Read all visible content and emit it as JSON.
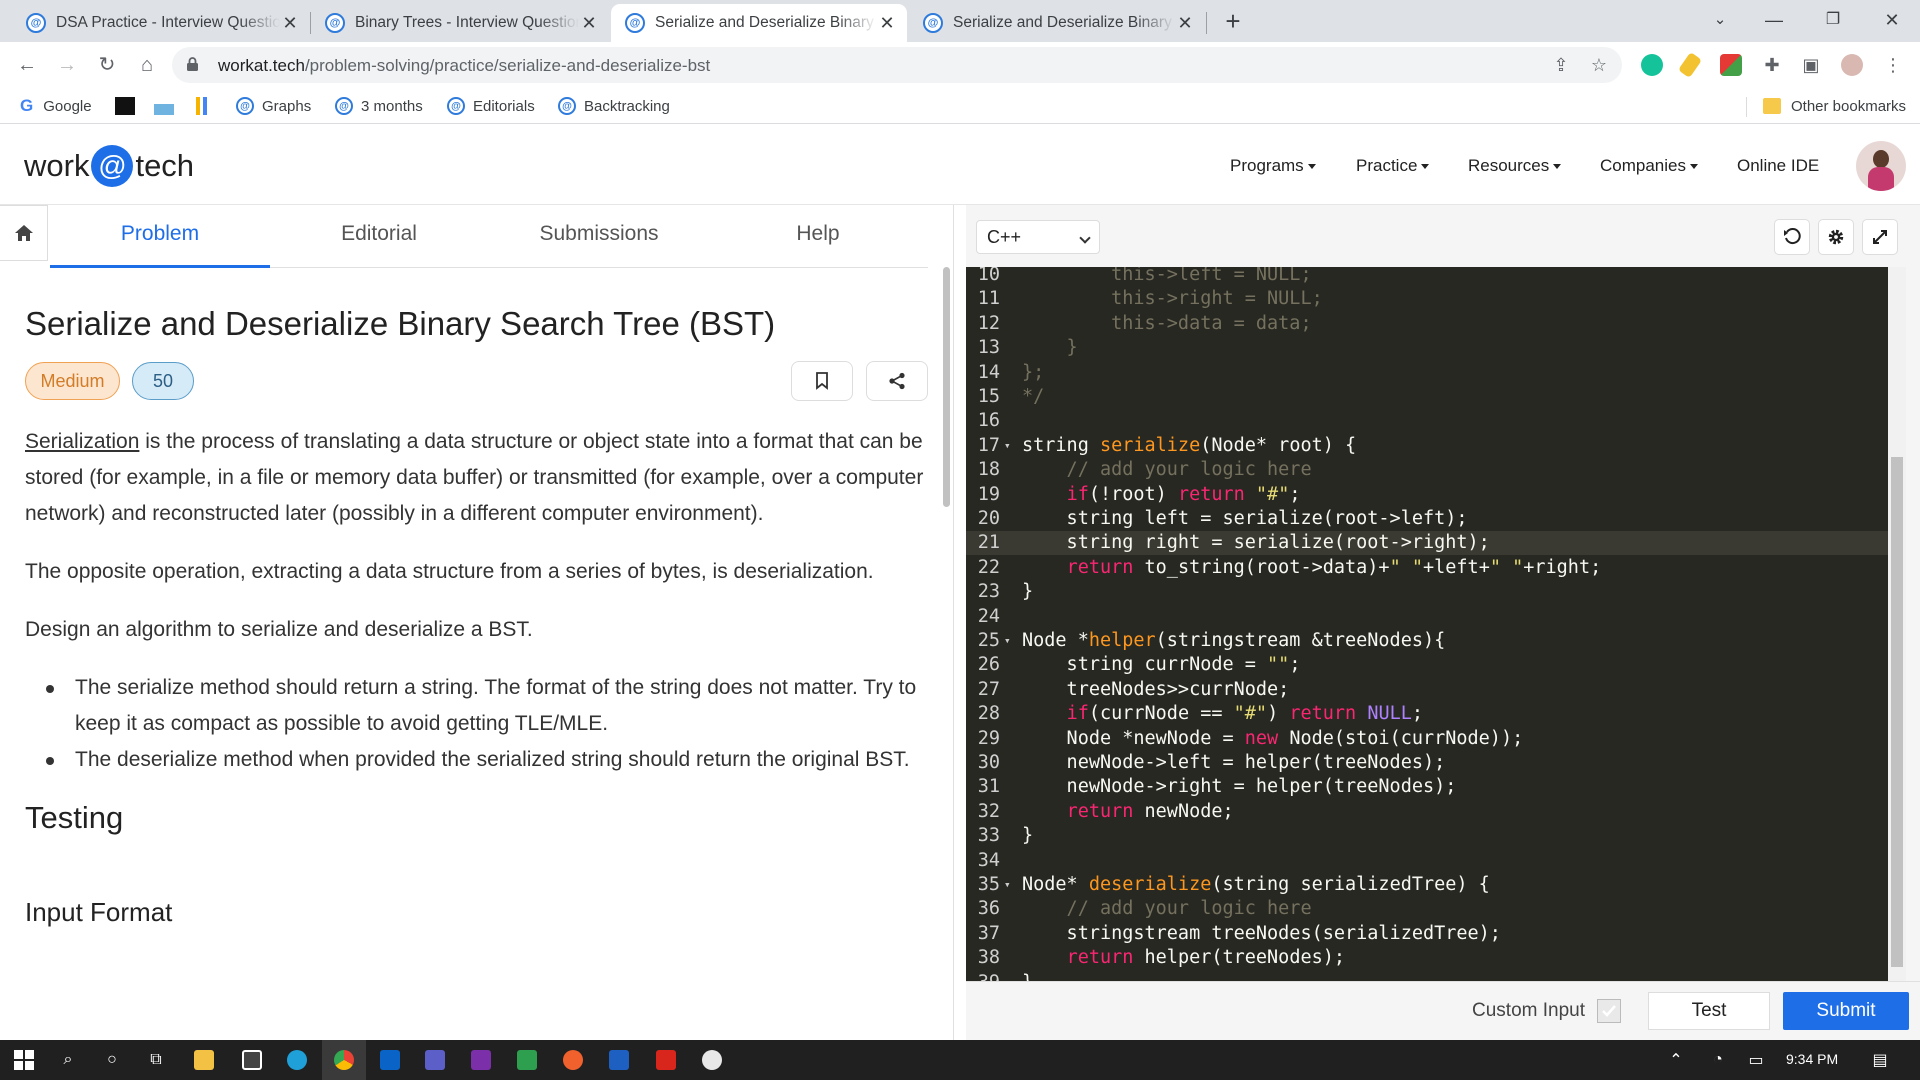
{
  "browser": {
    "tabs": [
      {
        "title": "DSA Practice - Interview Questions",
        "active": false
      },
      {
        "title": "Binary Trees - Interview Questions",
        "active": false
      },
      {
        "title": "Serialize and Deserialize Binary Search Tree",
        "active": true
      },
      {
        "title": "Serialize and Deserialize Binary Search Tree",
        "active": false
      }
    ],
    "url_host": "workat.tech",
    "url_path": "/problem-solving/practice/serialize-and-deserialize-bst",
    "bookmarks": [
      "Google",
      "Graphs",
      "3 months",
      "Editorials",
      "Backtracking"
    ],
    "other_bookmarks": "Other bookmarks"
  },
  "site": {
    "logo_left": "work",
    "logo_at": "@",
    "logo_right": "tech",
    "nav": [
      "Programs",
      "Practice",
      "Resources",
      "Companies",
      "Online IDE"
    ]
  },
  "problem": {
    "tabs": [
      "Problem",
      "Editorial",
      "Submissions",
      "Help"
    ],
    "title": "Serialize and Deserialize Binary Search Tree (BST)",
    "difficulty": "Medium",
    "points": "50",
    "para1_link": "Serialization",
    "para1_rest": " is the process of translating a data structure or object state into a format that can be stored (for example, in a file or memory data buffer) or transmitted (for example, over a computer network) and reconstructed later (possibly in a different computer environment).",
    "para2": "The opposite operation, extracting a data structure from a series of bytes, is deserialization.",
    "para3": "Design an algorithm to serialize and deserialize a BST.",
    "bullets": [
      "The serialize method should return a string. The format of the string does not matter. Try to keep it as compact as possible to avoid getting TLE/MLE.",
      "The deserialize method when provided the serialized string should return the original BST."
    ],
    "testing_heading": "Testing",
    "input_heading": "Input Format"
  },
  "editor": {
    "language": "C++",
    "custom_input_label": "Custom Input",
    "test_label": "Test",
    "submit_label": "Submit",
    "lines": [
      {
        "n": "10",
        "fold": "",
        "segs": [
          [
            "cm",
            "        this->left = NULL;"
          ]
        ]
      },
      {
        "n": "11",
        "fold": "",
        "segs": [
          [
            "cm",
            "        this->right = NULL;"
          ]
        ]
      },
      {
        "n": "12",
        "fold": "",
        "segs": [
          [
            "cm",
            "        this->data = data;"
          ]
        ]
      },
      {
        "n": "13",
        "fold": "",
        "segs": [
          [
            "cm",
            "    }"
          ]
        ]
      },
      {
        "n": "14",
        "fold": "",
        "segs": [
          [
            "cm",
            "};"
          ]
        ]
      },
      {
        "n": "15",
        "fold": "",
        "segs": [
          [
            "cm",
            "*/"
          ]
        ]
      },
      {
        "n": "16",
        "fold": "",
        "segs": [
          [
            "",
            ""
          ]
        ]
      },
      {
        "n": "17",
        "fold": "▾",
        "segs": [
          [
            "",
            "string "
          ],
          [
            "fn",
            "serialize"
          ],
          [
            "",
            "(Node* root) {"
          ]
        ]
      },
      {
        "n": "18",
        "fold": "",
        "segs": [
          [
            "cm",
            "    // add your logic here"
          ]
        ]
      },
      {
        "n": "19",
        "fold": "",
        "segs": [
          [
            "",
            "    "
          ],
          [
            "kw",
            "if"
          ],
          [
            "",
            "(!root) "
          ],
          [
            "kw",
            "return"
          ],
          [
            "",
            " "
          ],
          [
            "st",
            "\"#\""
          ],
          [
            "",
            ";"
          ]
        ]
      },
      {
        "n": "20",
        "fold": "",
        "segs": [
          [
            "",
            "    string left = serialize(root->left);"
          ]
        ]
      },
      {
        "n": "21",
        "fold": "",
        "hl": true,
        "segs": [
          [
            "",
            "    string right = serialize(root->right);"
          ]
        ]
      },
      {
        "n": "22",
        "fold": "",
        "segs": [
          [
            "",
            "    "
          ],
          [
            "kw",
            "return"
          ],
          [
            "",
            " to_string(root->data)+"
          ],
          [
            "st",
            "\" \""
          ],
          [
            "",
            "+left+"
          ],
          [
            "st",
            "\" \""
          ],
          [
            "",
            "+right;"
          ]
        ]
      },
      {
        "n": "23",
        "fold": "",
        "segs": [
          [
            "",
            "}"
          ]
        ]
      },
      {
        "n": "24",
        "fold": "",
        "segs": [
          [
            "",
            ""
          ]
        ]
      },
      {
        "n": "25",
        "fold": "▾",
        "segs": [
          [
            "",
            "Node *"
          ],
          [
            "fn",
            "helper"
          ],
          [
            "",
            "(stringstream &treeNodes){"
          ]
        ]
      },
      {
        "n": "26",
        "fold": "",
        "segs": [
          [
            "",
            "    string currNode = "
          ],
          [
            "st",
            "\"\""
          ],
          [
            "",
            ";"
          ]
        ]
      },
      {
        "n": "27",
        "fold": "",
        "segs": [
          [
            "",
            "    treeNodes>>currNode;"
          ]
        ]
      },
      {
        "n": "28",
        "fold": "",
        "segs": [
          [
            "",
            "    "
          ],
          [
            "kw",
            "if"
          ],
          [
            "",
            "(currNode == "
          ],
          [
            "st",
            "\"#\""
          ],
          [
            "",
            ") "
          ],
          [
            "kw",
            "return"
          ],
          [
            "",
            " "
          ],
          [
            "cn",
            "NULL"
          ],
          [
            "",
            ";"
          ]
        ]
      },
      {
        "n": "29",
        "fold": "",
        "segs": [
          [
            "",
            "    Node *newNode = "
          ],
          [
            "kw",
            "new"
          ],
          [
            "",
            " Node(stoi(currNode));"
          ]
        ]
      },
      {
        "n": "30",
        "fold": "",
        "segs": [
          [
            "",
            "    newNode->left = helper(treeNodes);"
          ]
        ]
      },
      {
        "n": "31",
        "fold": "",
        "segs": [
          [
            "",
            "    newNode->right = helper(treeNodes);"
          ]
        ]
      },
      {
        "n": "32",
        "fold": "",
        "segs": [
          [
            "",
            "    "
          ],
          [
            "kw",
            "return"
          ],
          [
            "",
            " newNode;"
          ]
        ]
      },
      {
        "n": "33",
        "fold": "",
        "segs": [
          [
            "",
            "}"
          ]
        ]
      },
      {
        "n": "34",
        "fold": "",
        "segs": [
          [
            "",
            ""
          ]
        ]
      },
      {
        "n": "35",
        "fold": "▾",
        "segs": [
          [
            "",
            "Node* "
          ],
          [
            "fn",
            "deserialize"
          ],
          [
            "",
            "(string serializedTree) {"
          ]
        ]
      },
      {
        "n": "36",
        "fold": "",
        "segs": [
          [
            "cm",
            "    // add your logic here"
          ]
        ]
      },
      {
        "n": "37",
        "fold": "",
        "segs": [
          [
            "",
            "    stringstream treeNodes(serializedTree);"
          ]
        ]
      },
      {
        "n": "38",
        "fold": "",
        "segs": [
          [
            "",
            "    "
          ],
          [
            "kw",
            "return"
          ],
          [
            "",
            " helper(treeNodes);"
          ]
        ]
      },
      {
        "n": "39",
        "fold": "",
        "segs": [
          [
            "",
            "}"
          ]
        ]
      }
    ]
  },
  "taskbar": {
    "time": "9:34 PM"
  },
  "colors": {
    "brand": "#1e6ee8",
    "editor_bg": "#272822"
  }
}
